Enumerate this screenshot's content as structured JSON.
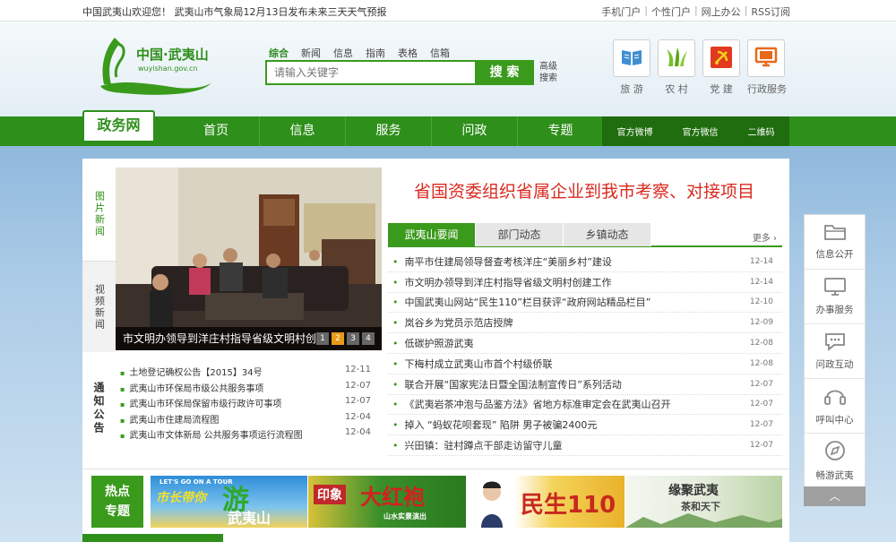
{
  "topbar": {
    "welcome": "中国武夷山欢迎您！ 武夷山市气象局12月13日发布未来三天天气预报",
    "links": [
      "手机门户",
      "个性门户",
      "网上办公",
      "RSS订阅"
    ]
  },
  "header": {
    "logo_text": "中国·武夷山",
    "logo_domain": "wuyishan.gov.cn",
    "search_tabs": [
      "综合",
      "新闻",
      "信息",
      "指南",
      "表格",
      "信箱"
    ],
    "search_placeholder": "请输入关键字",
    "search_button": "搜 索",
    "advanced_search": "高级搜索",
    "quick_links": [
      {
        "label": "旅 游",
        "icon": "book-icon"
      },
      {
        "label": "农 村",
        "icon": "grass-icon"
      },
      {
        "label": "党 建",
        "icon": "party-emblem-icon"
      },
      {
        "label": "行政服务",
        "icon": "monitor-icon"
      }
    ]
  },
  "nav": {
    "brand_tab": "政务网",
    "items": [
      "首页",
      "信息",
      "服务",
      "问政",
      "专题"
    ],
    "extras": [
      "官方微博",
      "官方微信",
      "二维码"
    ]
  },
  "main": {
    "vtabs": [
      "图片新闻",
      "视频新闻"
    ],
    "photo": {
      "caption": "市文明办领导到洋庄村指导省级文明村创",
      "pages": [
        "1",
        "2",
        "3",
        "4"
      ],
      "active_page": 2
    },
    "notice": {
      "title": "通知公告",
      "items": [
        {
          "title": "土地登记确权公告【2015】34号",
          "date": "12-11"
        },
        {
          "title": "武夷山市环保局市级公共服务事项",
          "date": "12-07"
        },
        {
          "title": "武夷山市环保局保留市级行政许可事项",
          "date": "12-07"
        },
        {
          "title": "武夷山市住建局流程图",
          "date": "12-04"
        },
        {
          "title": "武夷山市文体新局 公共服务事项运行流程图",
          "date": "12-04"
        }
      ]
    },
    "headline": "省国资委组织省属企业到我市考察、对接项目",
    "news_tabs": [
      "武夷山要闻",
      "部门动态",
      "乡镇动态"
    ],
    "more": "更多",
    "news": [
      {
        "title": "南平市住建局领导督查考核洋庄“美丽乡村”建设",
        "date": "12-14"
      },
      {
        "title": "市文明办领导到洋庄村指导省级文明村创建工作",
        "date": "12-14"
      },
      {
        "title": "中国武夷山网站“民生110”栏目获评“政府网站精品栏目”",
        "date": "12-10"
      },
      {
        "title": "岚谷乡为党员示范店授牌",
        "date": "12-09"
      },
      {
        "title": "低碳护照游武夷",
        "date": "12-08"
      },
      {
        "title": "下梅村成立武夷山市首个村级侨联",
        "date": "12-08"
      },
      {
        "title": "联合开展“国家宪法日暨全国法制宣传日”系列活动",
        "date": "12-07"
      },
      {
        "title": "《武夷岩茶冲泡与品鉴方法》省地方标准审定会在武夷山召开",
        "date": "12-07"
      },
      {
        "title": "掉入 “蚂蚁花呗套现” 陷阱 男子被骗2400元",
        "date": "12-07"
      },
      {
        "title": "兴田镇：驻村蹲点干部走访留守儿童",
        "date": "12-07"
      }
    ],
    "hot": {
      "tag_line1": "热点",
      "tag_line2": "专题",
      "banners": [
        {
          "text1": "LET'S GO ON A TOUR",
          "text2": "市长带你",
          "text3": "游",
          "text4": "武夷山"
        },
        {
          "text1": "印象",
          "text2": "大红袍",
          "text3": "山水实景演出"
        },
        {
          "text1": "民生110"
        },
        {
          "text1": "缘聚武夷",
          "text2": "茶和天下"
        }
      ]
    }
  },
  "side": {
    "items": [
      {
        "label": "信息公开",
        "icon": "folder-icon"
      },
      {
        "label": "办事服务",
        "icon": "monitor-icon"
      },
      {
        "label": "问政互动",
        "icon": "chat-icon"
      },
      {
        "label": "呼叫中心",
        "icon": "headset-icon"
      },
      {
        "label": "畅游武夷",
        "icon": "compass-icon"
      }
    ],
    "up": "︿"
  },
  "colors": {
    "brand_green": "#2f8f1b",
    "headline_red": "#d92a1f",
    "active_orange": "#e89a18"
  }
}
